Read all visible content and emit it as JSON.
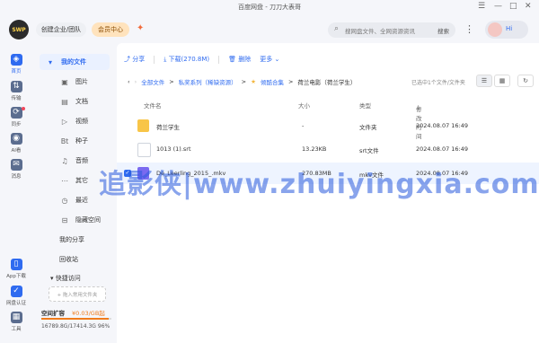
{
  "window": {
    "title": "百度网盘 - 刀刀大表哥",
    "controls": [
      "☰",
      "—",
      "□",
      "✕"
    ]
  },
  "header": {
    "avatar_text": "SWP",
    "enterprise_label": "创建企业/团队",
    "vip_label": "会员中心",
    "search_placeholder": "搜网盘文件、全网资源资讯",
    "search_button": "搜索",
    "user_greeting": "Hi"
  },
  "rail": [
    {
      "label": "首页",
      "icon": "home-icon",
      "color": "#2f6bf0"
    },
    {
      "label": "传输",
      "icon": "transfer-icon",
      "color": "#5b6d8f"
    },
    {
      "label": "同步",
      "icon": "sync-icon",
      "color": "#5b6d8f"
    },
    {
      "label": "AI看",
      "icon": "ai-icon",
      "color": "#5b6d8f"
    },
    {
      "label": "消息",
      "icon": "message-icon",
      "color": "#5b6d8f"
    },
    {
      "label": "App下载",
      "icon": "app-download-icon",
      "color": "#2f6bf0"
    },
    {
      "label": "网盘认证",
      "icon": "verify-icon",
      "color": "#2f6bf0"
    },
    {
      "label": "工具",
      "icon": "tools-icon",
      "color": "#5b6d8f"
    }
  ],
  "sidebar": {
    "my_files": "我的文件",
    "categories": [
      {
        "label": "图片",
        "icon": "image-icon",
        "glyph": "▣"
      },
      {
        "label": "文档",
        "icon": "document-icon",
        "glyph": "▤"
      },
      {
        "label": "视频",
        "icon": "video-icon",
        "glyph": "▷"
      },
      {
        "label": "种子",
        "icon": "torrent-icon",
        "glyph": "Bt"
      },
      {
        "label": "音频",
        "icon": "audio-icon",
        "glyph": "♫"
      },
      {
        "label": "其它",
        "icon": "other-icon",
        "glyph": "⋯"
      },
      {
        "label": "最近",
        "icon": "recent-icon",
        "glyph": "◷"
      },
      {
        "label": "隐藏空间",
        "icon": "hidden-space-icon",
        "glyph": "⊟"
      }
    ],
    "my_share": "我的分享",
    "recycle": "回收站",
    "quick_access": "快捷访问",
    "add_quick": "+ 拖入常用文件夹",
    "space_expand": "空间扩容",
    "space_price": "¥0.03/GB起",
    "space_usage": "16789.8G/17414.3G",
    "space_usage_pct": "96%",
    "space_fraction": 0.96
  },
  "toolbar": {
    "share": "分享",
    "download": "下载(270.8M)",
    "delete": "删除",
    "more": "更多"
  },
  "breadcrumb": {
    "items": [
      "全部文件",
      "私奖系列（稀缺资源）",
      "倾酷合集",
      "荷兰电影（荷兰学生）"
    ],
    "loaded": "已选中1个文件/文件夹"
  },
  "table": {
    "headers": {
      "name": "文件名",
      "size": "大小",
      "type": "类型",
      "modified": "修改时间"
    },
    "rows": [
      {
        "name": "荷兰学生",
        "size": "-",
        "type": "文件夹",
        "modified": "2024.08.07 16:49",
        "icon": "folder-icon",
        "color": "#f8c548",
        "selected": false
      },
      {
        "name": "1013 (1).srt",
        "size": "13.23KB",
        "type": "srt文件",
        "modified": "2024.08.07 16:49",
        "icon": "srt-file-icon",
        "color": "#dfe3ea",
        "selected": false
      },
      {
        "name": "De_Leerling_2015_.mkv",
        "size": "270.83MB",
        "type": "mkv文件",
        "modified": "2024.08.07 16:49",
        "icon": "video-file-icon",
        "color": "#7a6af0",
        "selected": true
      }
    ]
  },
  "watermark": "追影侠|www.zhuiyingxia.com"
}
